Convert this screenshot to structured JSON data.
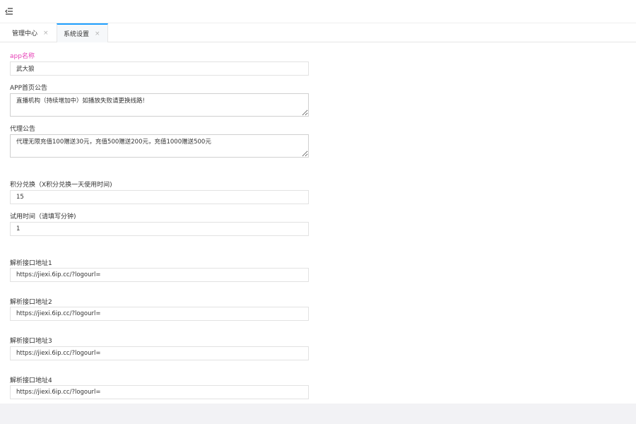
{
  "topbar": {
    "menu_icon": "menu-fold-icon"
  },
  "tabs": [
    {
      "label": "管理中心",
      "close": "×"
    },
    {
      "label": "系统设置",
      "close": "×"
    }
  ],
  "form": {
    "app_name": {
      "label": "app名称",
      "value": "武大狼"
    },
    "home_notice": {
      "label": "APP首页公告",
      "value": "直播机构（持续增加中）如播放失败请更换线路!"
    },
    "agent_notice": {
      "label": "代理公告",
      "value": "代理无限充值100赠送30元，充值500赠送200元，充值1000赠送500元"
    },
    "points_exchange": {
      "label": "积分兑换（X积分兑换一天使用时间)",
      "value": "15"
    },
    "trial_time": {
      "label": "试用时间（请填写分钟)",
      "value": "1"
    },
    "parse_api_1": {
      "label": "解析接口地址1",
      "value": "https://jiexi.6ip.cc/?logourl="
    },
    "parse_api_2": {
      "label": "解析接口地址2",
      "value": "https://jiexi.6ip.cc/?logourl="
    },
    "parse_api_3": {
      "label": "解析接口地址3",
      "value": "https://jiexi.6ip.cc/?logourl="
    },
    "parse_api_4": {
      "label": "解析接口地址4",
      "value": "https://jiexi.6ip.cc/?logourl="
    }
  },
  "colors": {
    "accent": "#1e9fff",
    "highlight_label": "#e63fb6",
    "footer_bg": "#f2f2f5"
  }
}
